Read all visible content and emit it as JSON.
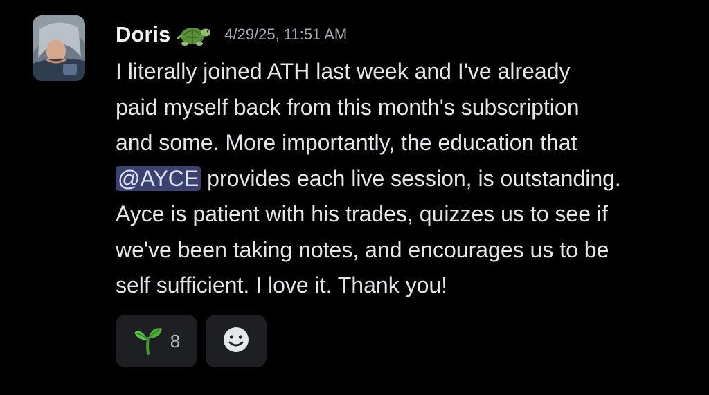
{
  "message": {
    "author": {
      "name": "Doris",
      "badge_icon": "turtle-icon"
    },
    "timestamp": "4/29/25, 11:51 AM",
    "content": {
      "line1": "I literally joined ATH last week and I've already",
      "line2": "paid myself back from this month's subscription",
      "line3": "and some. More importantly, the education that",
      "mention": "@AYCE",
      "line4_rest": " provides each live session, is outstanding.",
      "line5": "Ayce is patient with his trades, quizzes us to see if",
      "line6": "we've been taking notes, and encourages us to be",
      "line7": "self sufficient. I love it. Thank you!"
    },
    "reactions": [
      {
        "emoji_icon": "seedling-icon",
        "count": "8"
      }
    ],
    "add_reaction_icon": "smiley-icon"
  },
  "colors": {
    "background": "#000000",
    "text": "#e4e6ea",
    "timestamp": "#a8abb3",
    "mention_bg": "#3c4270",
    "mention_text": "#dee0fc",
    "reaction_bg": "#1e1f22"
  }
}
